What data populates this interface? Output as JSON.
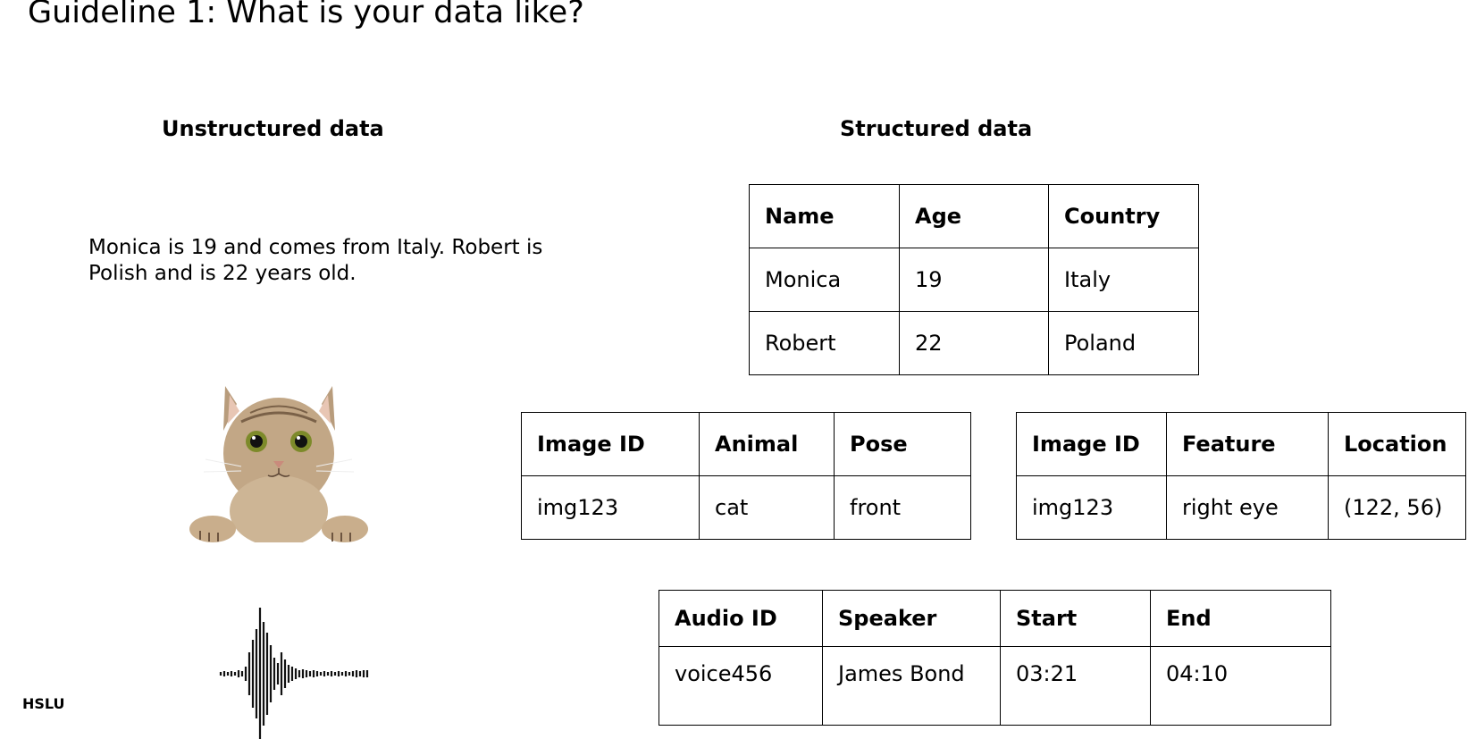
{
  "title": "Guideline 1: What is your data like?",
  "headings": {
    "unstructured": "Unstructured data",
    "structured": "Structured data"
  },
  "unstructured_text": "Monica is 19 and comes from Italy. Robert is Polish and is 22 years old.",
  "people_table": {
    "headers": [
      "Name",
      "Age",
      "Country"
    ],
    "rows": [
      [
        "Monica",
        "19",
        "Italy"
      ],
      [
        "Robert",
        "22",
        "Poland"
      ]
    ]
  },
  "image_table": {
    "headers": [
      "Image ID",
      "Animal",
      "Pose"
    ],
    "rows": [
      [
        "img123",
        "cat",
        "front"
      ]
    ]
  },
  "feature_table": {
    "headers": [
      "Image ID",
      "Feature",
      "Location"
    ],
    "rows": [
      [
        "img123",
        "right eye",
        "(122, 56)"
      ]
    ]
  },
  "audio_table": {
    "headers": [
      "Audio ID",
      "Speaker",
      "Start",
      "End"
    ],
    "rows": [
      [
        "voice456",
        "James Bond",
        "03:21",
        "04:10"
      ]
    ]
  },
  "logo": "HSLU"
}
